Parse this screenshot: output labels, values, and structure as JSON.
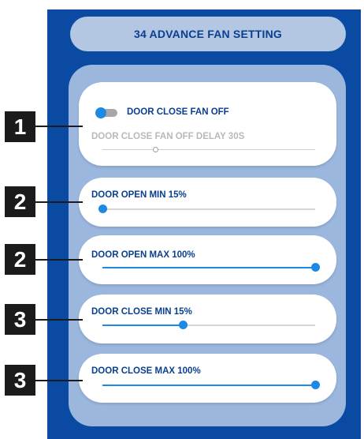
{
  "header": {
    "title": "34 ADVANCE FAN SETTING"
  },
  "settings": [
    {
      "toggle": {
        "label": "DOOR CLOSE FAN OFF",
        "on": true
      },
      "delay": {
        "label": "DOOR CLOSE FAN OFF DELAY 30S",
        "value_fraction": 0.25,
        "enabled": false
      }
    },
    {
      "label": "DOOR OPEN MIN 15%",
      "value_fraction": 0.0
    },
    {
      "label": "DOOR OPEN MAX 100%",
      "value_fraction": 1.0
    },
    {
      "label": "DOOR CLOSE MIN 15%",
      "value_fraction": 0.38
    },
    {
      "label": "DOOR CLOSE MAX 100%",
      "value_fraction": 1.0
    }
  ],
  "callouts": [
    "1",
    "2",
    "2",
    "3",
    "3"
  ],
  "colors": {
    "panel": "#0a4aa3",
    "accent": "#1e88e5",
    "label": "#0a3f8f",
    "callout": "#1b1b1b"
  }
}
